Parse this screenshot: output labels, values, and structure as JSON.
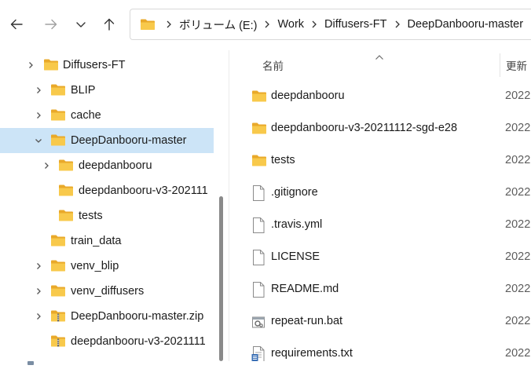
{
  "address_bar": {
    "crumbs": [
      "ボリューム (E:)",
      "Work",
      "Diffusers-FT",
      "DeepDanbooru-master"
    ]
  },
  "nav_tree": {
    "items": [
      {
        "label": "Diffusers-FT",
        "icon": "folder-icon",
        "expandable": true
      },
      {
        "label": "BLIP",
        "icon": "folder-icon",
        "expandable": true
      },
      {
        "label": "cache",
        "icon": "folder-icon",
        "expandable": true
      },
      {
        "label": "DeepDanbooru-master",
        "icon": "folder-icon",
        "expandable": true,
        "expanded": true,
        "selected": true
      },
      {
        "label": "deepdanbooru",
        "icon": "folder-icon",
        "expandable": true
      },
      {
        "label": "deepdanbooru-v3-202111",
        "icon": "folder-icon",
        "expandable": false
      },
      {
        "label": "tests",
        "icon": "folder-icon",
        "expandable": false
      },
      {
        "label": "train_data",
        "icon": "folder-icon",
        "expandable": false
      },
      {
        "label": "venv_blip",
        "icon": "folder-icon",
        "expandable": true
      },
      {
        "label": "venv_diffusers",
        "icon": "folder-icon",
        "expandable": true
      },
      {
        "label": "DeepDanbooru-master.zip",
        "icon": "zip-folder-icon",
        "expandable": true
      },
      {
        "label": "deepdanbooru-v3-2021111",
        "icon": "zip-folder-icon",
        "expandable": false
      }
    ]
  },
  "content": {
    "columns": {
      "name": "名前",
      "date": "更新"
    },
    "files": [
      {
        "name": "deepdanbooru",
        "date": "2022",
        "icon": "folder-icon"
      },
      {
        "name": "deepdanbooru-v3-20211112-sgd-e28",
        "date": "2022",
        "icon": "folder-icon"
      },
      {
        "name": "tests",
        "date": "2022",
        "icon": "folder-icon"
      },
      {
        "name": ".gitignore",
        "date": "2022",
        "icon": "document-icon"
      },
      {
        "name": ".travis.yml",
        "date": "2022",
        "icon": "document-icon"
      },
      {
        "name": "LICENSE",
        "date": "2022",
        "icon": "document-icon"
      },
      {
        "name": "README.md",
        "date": "2022",
        "icon": "document-icon"
      },
      {
        "name": "repeat-run.bat",
        "date": "2022",
        "icon": "batch-file-icon"
      },
      {
        "name": "requirements.txt",
        "date": "2022",
        "icon": "text-file-icon"
      }
    ]
  },
  "colors": {
    "folder": "#f8c94b",
    "folder_dark": "#e9a92a",
    "selection": "#cce4f7",
    "accent": "#0067c0"
  }
}
